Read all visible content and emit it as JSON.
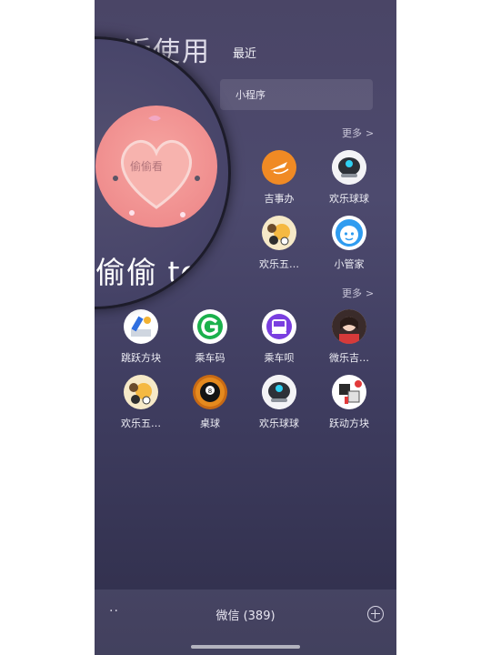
{
  "header": {
    "blurred_title": "最近使用",
    "section_title": "最近",
    "search_text": "小程序",
    "more_label": "更多",
    "more_chevron": ">"
  },
  "magnifier": {
    "avatar_text": "偷偷看",
    "zoomed_name": "偷偷 to..",
    "accent_color": "#f08f8f"
  },
  "recent_row1": [
    {
      "label": "吉事办",
      "icon": "flight-icon"
    },
    {
      "label": "欢乐球球",
      "icon": "ball-robot-icon"
    }
  ],
  "recent_row2": [
    {
      "label": "欢乐五…",
      "icon": "cartoon-game-icon"
    },
    {
      "label": "小管家",
      "icon": "face-badge-icon"
    }
  ],
  "mine_row1": [
    {
      "label": "跳跃方块",
      "icon": "jump-block-icon"
    },
    {
      "label": "乘车码",
      "icon": "g-logo-icon"
    },
    {
      "label": "乘车呗",
      "icon": "bus-icon"
    },
    {
      "label": "微乐吉…",
      "icon": "portrait-game-icon"
    }
  ],
  "mine_row2": [
    {
      "label": "欢乐五…",
      "icon": "cartoon-game-icon"
    },
    {
      "label": "桌球",
      "icon": "eight-ball-icon"
    },
    {
      "label": "欢乐球球",
      "icon": "ball-robot-icon"
    },
    {
      "label": "跃动方块",
      "icon": "dice-block-icon"
    }
  ],
  "bottom": {
    "dots": "··",
    "title": "微信 (389)"
  }
}
